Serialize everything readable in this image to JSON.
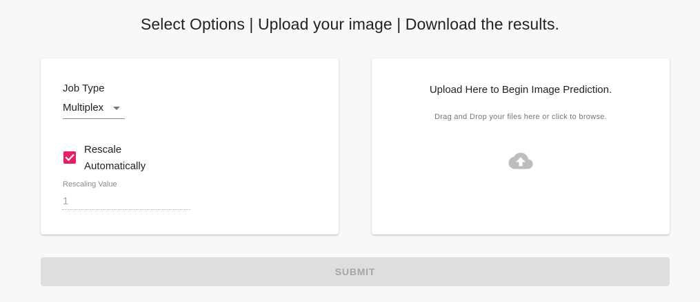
{
  "header": {
    "title": "Select Options | Upload your image | Download the results."
  },
  "options": {
    "job_type_label": "Job Type",
    "job_type_value": "Multiplex",
    "rescale_label": "Rescale Automatically",
    "rescale_checked": true,
    "rescaling_value_label": "Rescaling Value",
    "rescaling_value": "1"
  },
  "upload": {
    "title": "Upload Here to Begin Image Prediction.",
    "subtitle": "Drag and Drop your files here or click to browse.",
    "icon": "cloud-upload-icon"
  },
  "actions": {
    "submit_label": "SUBMIT",
    "submit_disabled": true
  },
  "colors": {
    "accent": "#e91e63",
    "background": "#f8f8f8",
    "disabled_button": "#dedede",
    "icon_grey": "#bdbdbd"
  }
}
